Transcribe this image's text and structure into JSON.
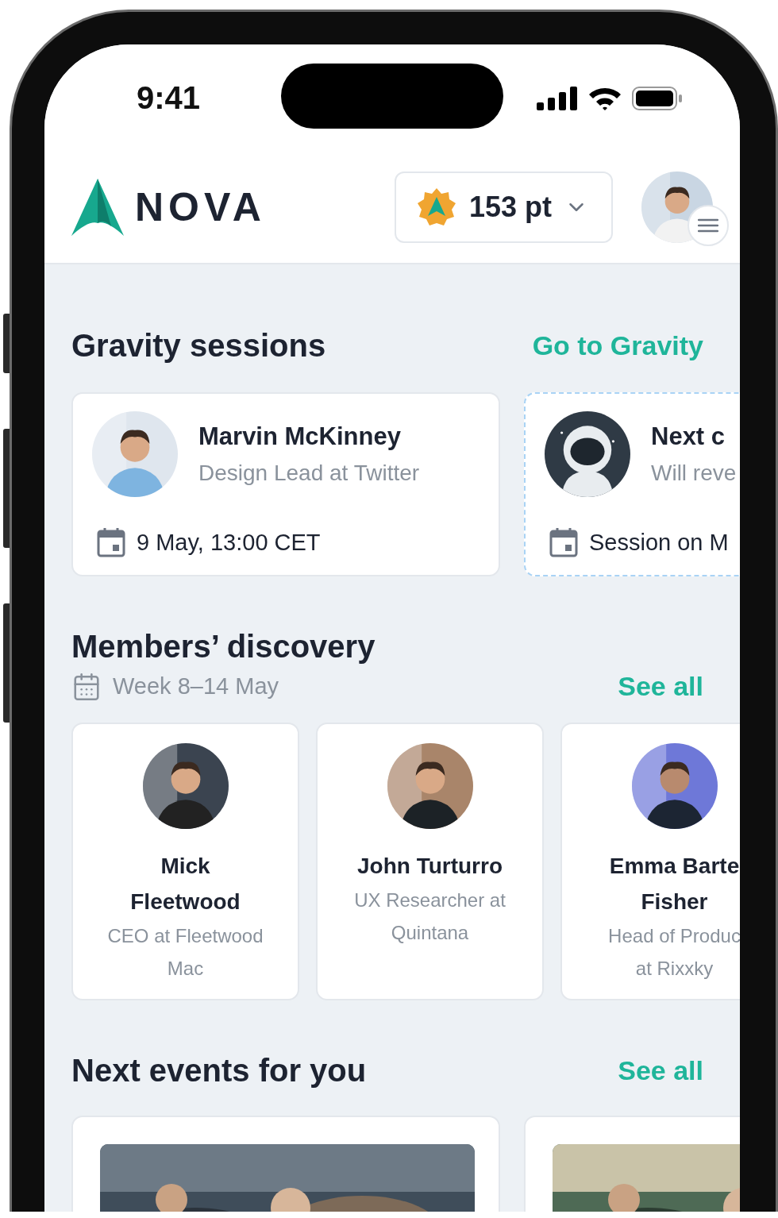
{
  "status_bar": {
    "time": "9:41"
  },
  "header": {
    "logo": "NOVA",
    "points": "153 pt"
  },
  "gravity": {
    "title": "Gravity sessions",
    "link": "Go to Gravity",
    "sessions": [
      {
        "kind": "booked",
        "name": "Marvin McKinney",
        "role": "Design Lead at Twitter",
        "date": "9 May, 13:00 CET"
      },
      {
        "kind": "upcoming",
        "name": "Next c",
        "role": "Will reve",
        "date": "Session on M"
      }
    ]
  },
  "discovery": {
    "title": "Members’ discovery",
    "week": "Week 8–14 May",
    "link": "See all",
    "members": [
      {
        "name": [
          "Mick",
          "Fleetwood"
        ],
        "role": [
          "CEO at Fleetwood",
          "Mac"
        ]
      },
      {
        "name": [
          "John Turturro"
        ],
        "role": [
          "UX Researcher at",
          "Quintana"
        ]
      },
      {
        "name": [
          "Emma Barte",
          "Fisher"
        ],
        "role": [
          "Head of Produc",
          "at Rixxky"
        ]
      }
    ]
  },
  "events": {
    "title": "Next events for you",
    "link": "See all"
  }
}
